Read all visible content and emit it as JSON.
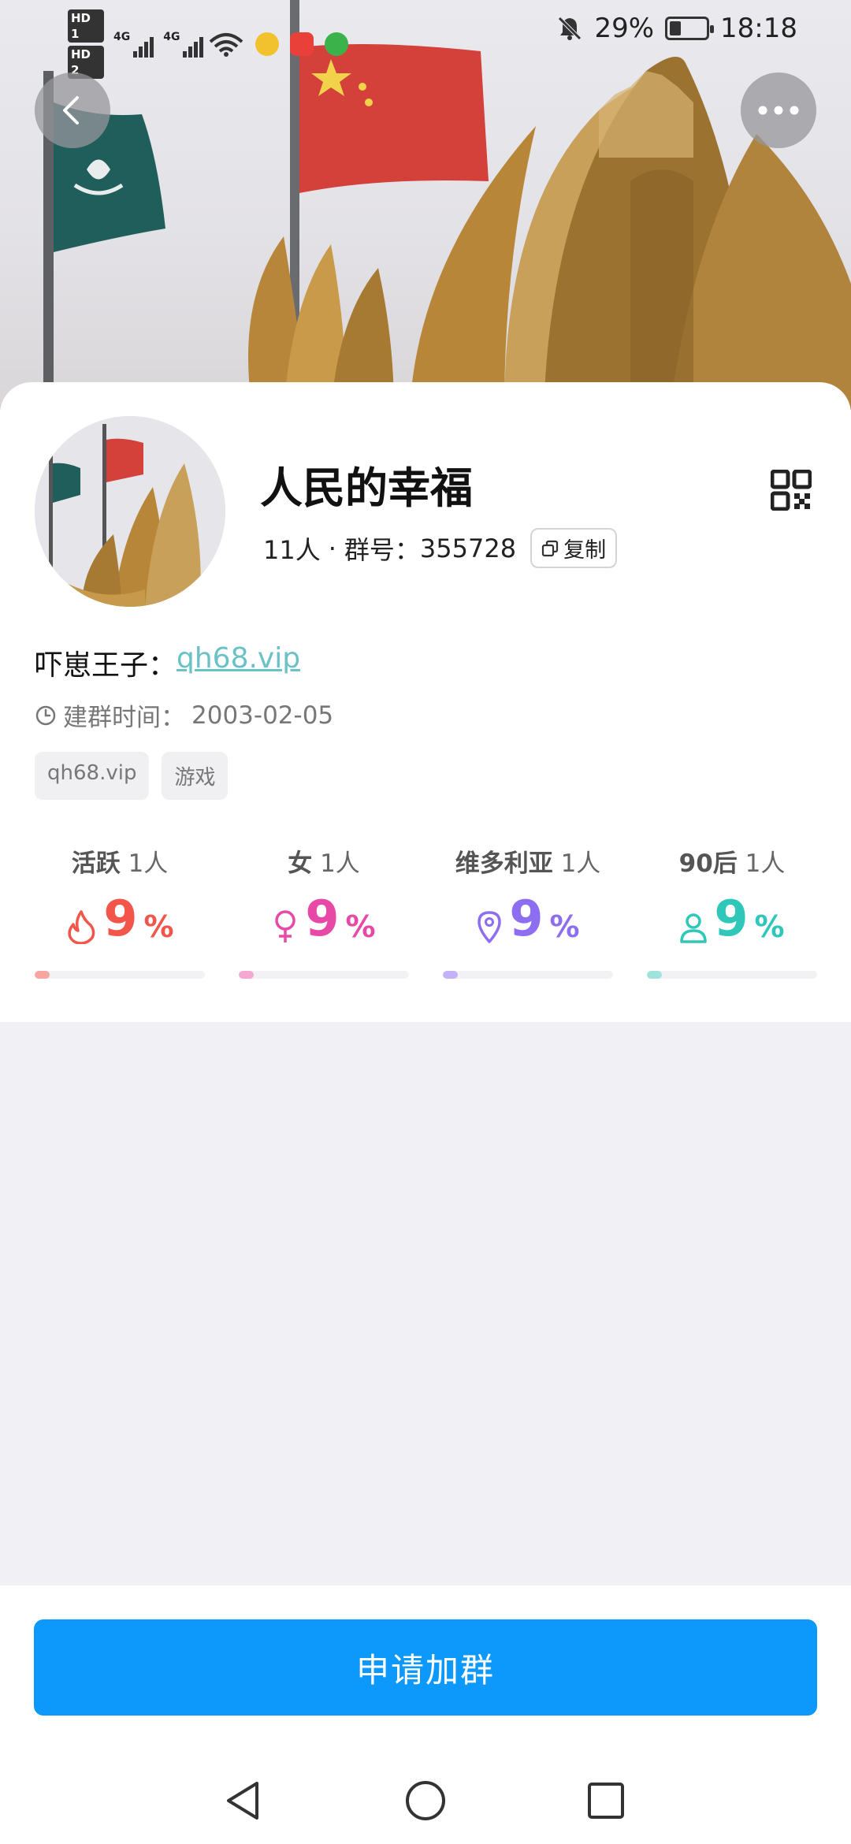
{
  "status_bar": {
    "hd1": "HD 1",
    "hd2": "HD 2",
    "network1": "4G",
    "network2": "4G",
    "battery": "29%",
    "battery_level": 0.29,
    "time": "18:18",
    "icons": [
      "wifi-icon",
      "weibo-icon",
      "huawei-appgallery-icon",
      "pop-app-icon",
      "mute-bell-icon"
    ]
  },
  "header": {
    "back_icon": "chevron-left-icon",
    "more_icon": "more-dots-icon"
  },
  "group": {
    "name": "人民的幸福",
    "members": "11人",
    "separator": "·",
    "id_label": "群号：",
    "id": "355728",
    "copy_label": "复制",
    "owner_label": "吓崽王子：",
    "owner_link": "qh68.vip",
    "created_label": "建群时间：",
    "created_date": "2003-02-05",
    "tags": [
      "qh68.vip",
      "游戏"
    ]
  },
  "stats": [
    {
      "label": "活跃",
      "count": "1人",
      "icon": "flame-icon",
      "value": "9",
      "unit": "%",
      "percent": 9,
      "color": "#f2554a"
    },
    {
      "label": "女",
      "count": "1人",
      "icon": "female-icon",
      "value": "9",
      "unit": "%",
      "percent": 9,
      "color": "#e74aa6"
    },
    {
      "label": "维多利亚",
      "count": "1人",
      "icon": "location-pin-icon",
      "value": "9",
      "unit": "%",
      "percent": 9,
      "color": "#8e6ef0"
    },
    {
      "label": "90后",
      "count": "1人",
      "icon": "person-icon",
      "value": "9",
      "unit": "%",
      "percent": 9,
      "color": "#2ec7b9"
    }
  ],
  "actions": {
    "join_label": "申请加群"
  },
  "navbar": {
    "back": "nav-back-icon",
    "home": "nav-home-icon",
    "recents": "nav-recents-icon"
  }
}
